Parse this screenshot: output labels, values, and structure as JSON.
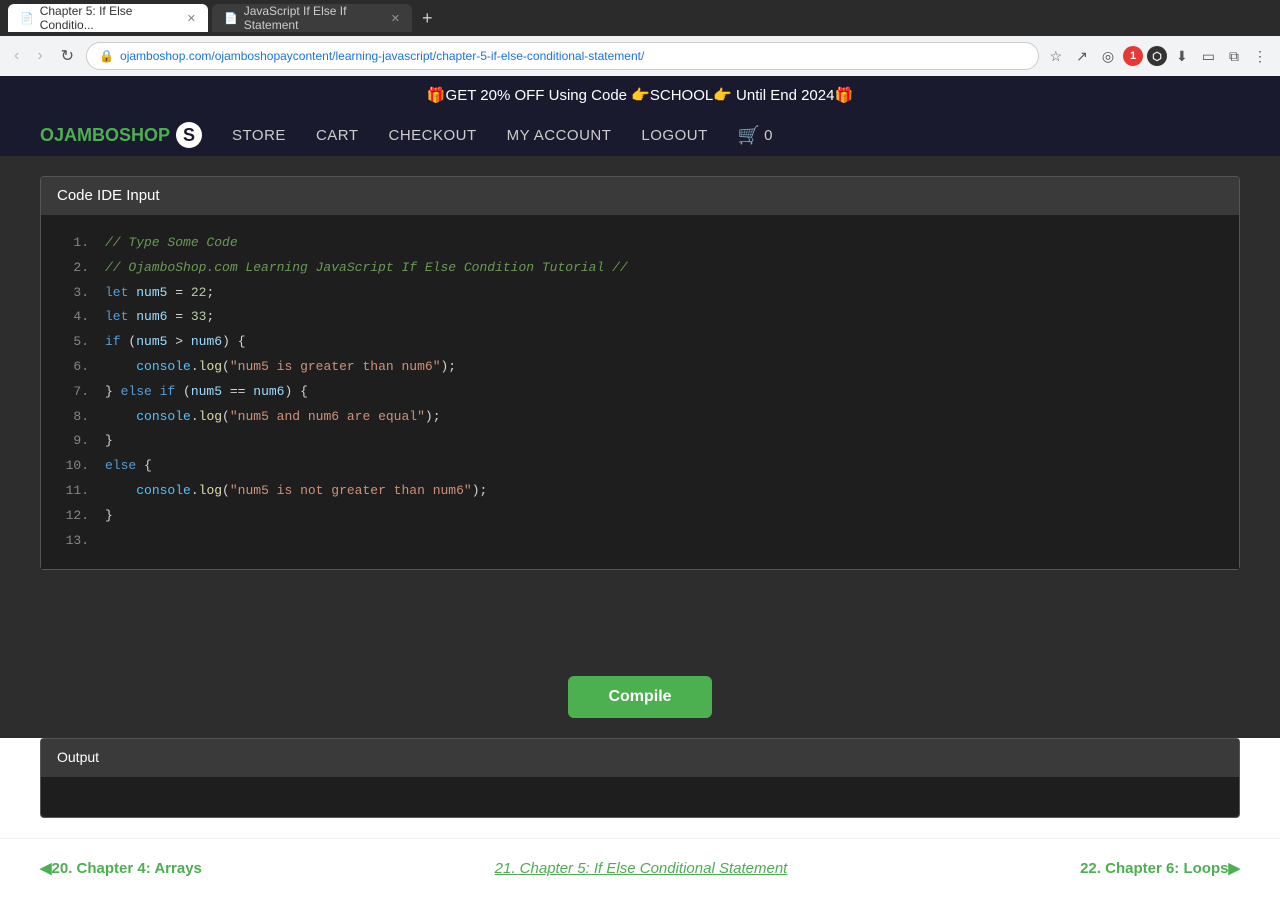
{
  "browser": {
    "tabs": [
      {
        "id": "tab1",
        "title": "Chapter 5: If Else Conditio...",
        "icon": "📄",
        "active": true
      },
      {
        "id": "tab2",
        "title": "JavaScript If Else If Statement",
        "icon": "📄",
        "active": false
      }
    ],
    "url": "ojamboshop.com/ojamboshopaycontent/learning-javascript/chapter-5-if-else-conditional-statement/",
    "nav_icons": [
      "🔍",
      "⭐",
      "↷",
      "↶",
      "⋮"
    ]
  },
  "promo": {
    "text": "🎁GET 20% OFF Using Code 👉SCHOOL👉 Until End 2024🎁"
  },
  "nav": {
    "logo_text": "OJAMBOSHOP",
    "logo_letter": "S",
    "links": [
      {
        "id": "store",
        "label": "STORE"
      },
      {
        "id": "cart",
        "label": "CART"
      },
      {
        "id": "checkout",
        "label": "CHECKOUT"
      },
      {
        "id": "my-account",
        "label": "MY ACCOUNT"
      },
      {
        "id": "logout",
        "label": "LOGOUT"
      }
    ],
    "cart_count": "0"
  },
  "code_ide": {
    "header": "Code IDE Input",
    "lines": [
      {
        "num": "1.",
        "code": "// Type Some Code",
        "type": "comment"
      },
      {
        "num": "2.",
        "code": "// OjamboShop.com Learning JavaScript If Else Condition Tutorial //",
        "type": "comment"
      },
      {
        "num": "3.",
        "code": "let num5 = 22;",
        "type": "code"
      },
      {
        "num": "4.",
        "code": "let num6 = 33;",
        "type": "code"
      },
      {
        "num": "5.",
        "code": "if (num5 > num6) {",
        "type": "code"
      },
      {
        "num": "6.",
        "code": "    console.log(\"num5 is greater than num6\");",
        "type": "code"
      },
      {
        "num": "7.",
        "code": "} else if (num5 == num6) {",
        "type": "code"
      },
      {
        "num": "8.",
        "code": "    console.log(\"num5 and num6 are equal\");",
        "type": "code"
      },
      {
        "num": "9.",
        "code": "}",
        "type": "code"
      },
      {
        "num": "10.",
        "code": "else {",
        "type": "code"
      },
      {
        "num": "11.",
        "code": "    console.log(\"num5 is not greater than num6\");",
        "type": "code"
      },
      {
        "num": "12.",
        "code": "}",
        "type": "code"
      },
      {
        "num": "13.",
        "code": "",
        "type": "code"
      }
    ]
  },
  "compile_button": "Compile",
  "output": {
    "header": "Output"
  },
  "chapter_nav": {
    "prev_label": "◀20. Chapter 4: Arrays",
    "current_label": "21. Chapter 5: If Else Conditional Statement",
    "next_label": "22. Chapter 6: Loops▶"
  }
}
